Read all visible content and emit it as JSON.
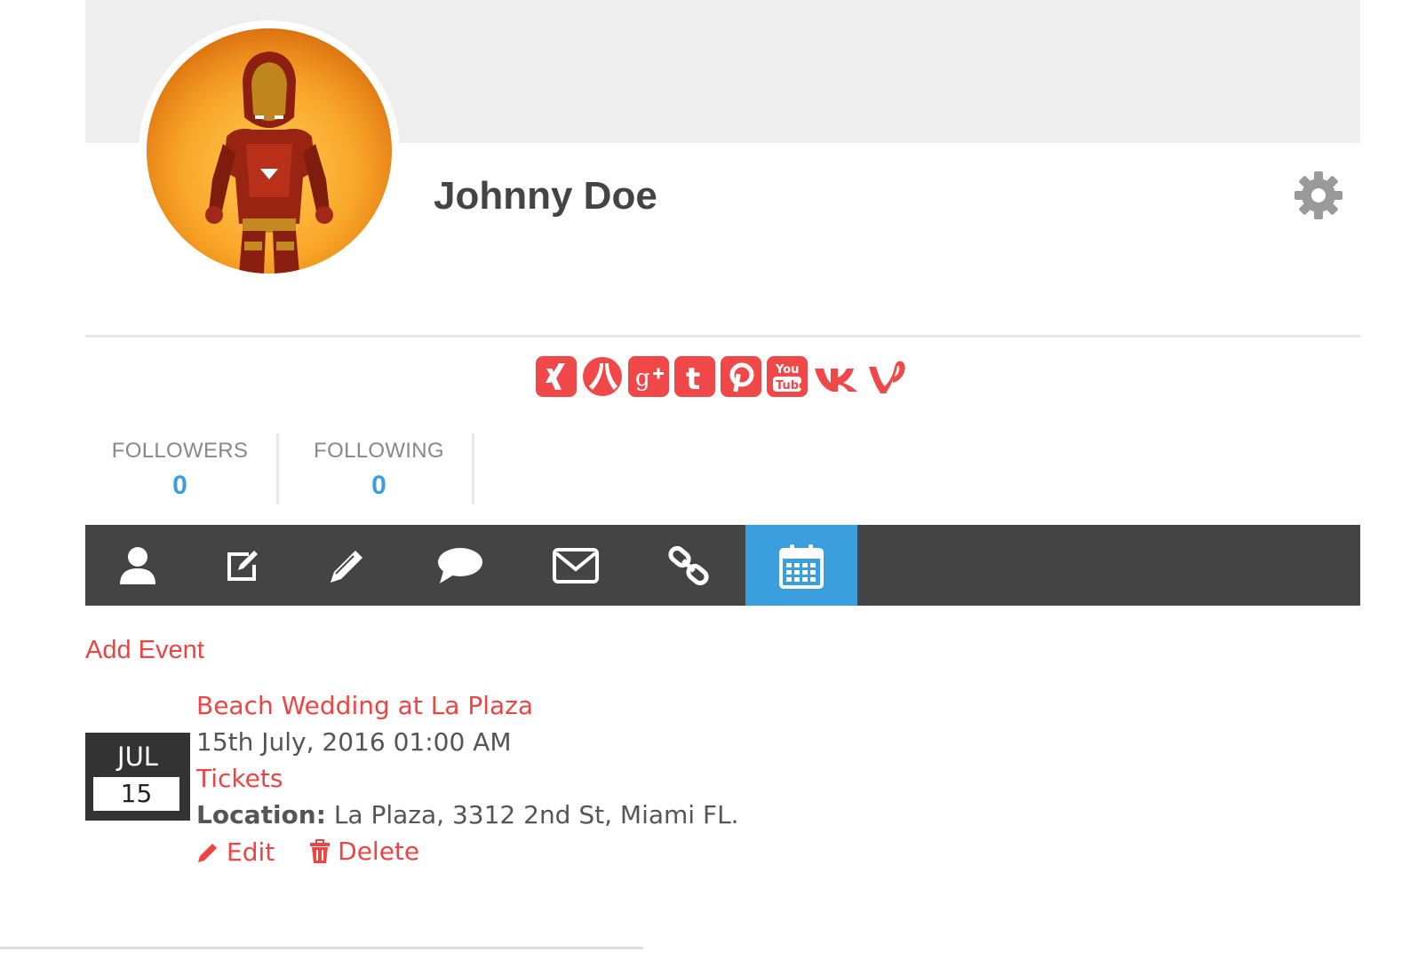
{
  "profile": {
    "name": "Johnny Doe",
    "avatar_icon": "iron-man-avatar"
  },
  "social_links": [
    {
      "name": "xing-icon"
    },
    {
      "name": "renren-icon"
    },
    {
      "name": "google-plus-icon"
    },
    {
      "name": "tumblr-icon"
    },
    {
      "name": "pinterest-icon"
    },
    {
      "name": "youtube-icon"
    },
    {
      "name": "vk-icon"
    },
    {
      "name": "vine-icon"
    }
  ],
  "stats": {
    "followers_label": "FOLLOWERS",
    "followers_value": "0",
    "following_label": "FOLLOWING",
    "following_value": "0"
  },
  "nav": {
    "items": [
      "user-icon",
      "edit-icon",
      "pencil-icon",
      "comment-icon",
      "envelope-icon",
      "link-icon",
      "calendar-icon"
    ],
    "active": "calendar-icon"
  },
  "events": {
    "add_label": "Add Event",
    "list": [
      {
        "month": "JUL",
        "day": "15",
        "title": "Beach Wedding at La Plaza",
        "datetime": "15th July, 2016 01:00 AM",
        "tickets_label": "Tickets",
        "location_label": "Location:",
        "location": "La Plaza, 3312 2nd St, Miami FL.",
        "edit_label": "Edit",
        "delete_label": "Delete"
      }
    ]
  },
  "colors": {
    "accent_red": "#ee4444",
    "accent_blue": "#3a9fdc",
    "navbar": "#444444"
  }
}
